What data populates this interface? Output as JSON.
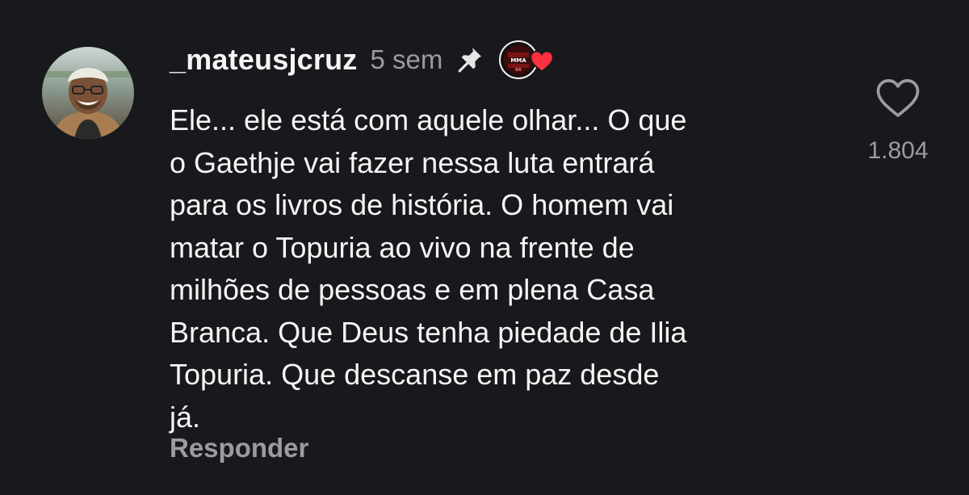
{
  "comment": {
    "username": "_mateusjcruz",
    "timestamp": "5 sem",
    "pinned": true,
    "creator_badge": {
      "label": "MMA",
      "sub_label": "BR",
      "liked_by_creator": true,
      "heart_color": "#ff3040"
    },
    "lines": [
      "Ele... ele está com aquele olhar... O que",
      "o Gaethje vai fazer nessa luta entrará",
      "para os livros de história. O homem vai",
      "matar o Topuria ao vivo na frente de",
      "milhões de pessoas e em plena Casa",
      "Branca. Que Deus tenha piedade de Ilia",
      "Topuria. Que descanse em paz desde",
      "já."
    ],
    "reply_label": "Responder",
    "like_count": "1.804"
  },
  "colors": {
    "background": "#17191c",
    "text_primary": "#f5f5f5",
    "text_secondary": "#9a9ca1"
  },
  "icons": {
    "pin": "pin-icon",
    "like": "heart-outline-icon",
    "creator_heart": "heart-filled-icon"
  }
}
